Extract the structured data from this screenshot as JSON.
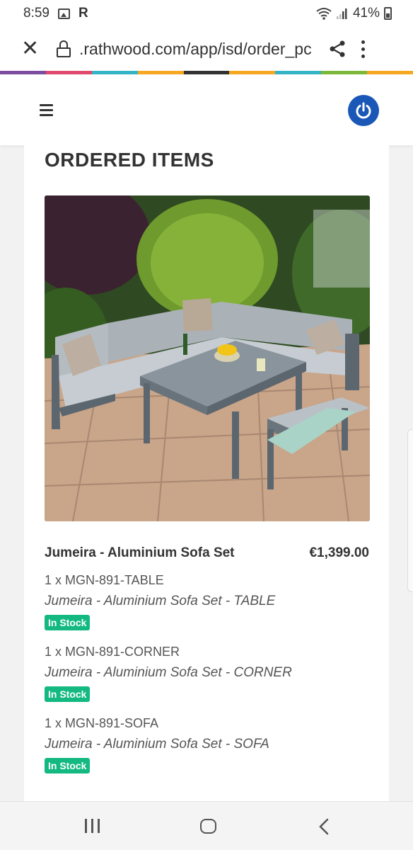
{
  "status_bar": {
    "time": "8:59",
    "r_label": "R",
    "battery": "41%"
  },
  "browser": {
    "url": ".rathwood.com/app/isd/order_pc"
  },
  "strip_colors": [
    "#7c4ca0",
    "#e04a6f",
    "#34b4c6",
    "#f7a823",
    "#333333",
    "#f7a823",
    "#34b4c6",
    "#7cb83a",
    "#f7a823"
  ],
  "section": {
    "title": "ORDERED ITEMS"
  },
  "product": {
    "name": "Jumeira - Aluminium Sofa Set",
    "price": "€1,399.00",
    "items": [
      {
        "sku": "1 x MGN-891-TABLE",
        "desc": "Jumeira - Aluminium Sofa Set - TABLE",
        "stock": "In Stock"
      },
      {
        "sku": "1 x MGN-891-CORNER",
        "desc": "Jumeira - Aluminium Sofa Set - CORNER",
        "stock": "In Stock"
      },
      {
        "sku": "1 x MGN-891-SOFA",
        "desc": "Jumeira - Aluminium Sofa Set - SOFA",
        "stock": "In Stock"
      }
    ]
  },
  "colors": {
    "accent": "#1b57b7",
    "in_stock": "#13b981"
  },
  "icons": {
    "close": "close-icon",
    "lock": "lock-icon",
    "share": "share-icon",
    "menu": "more-vert-icon",
    "hamburger": "hamburger-icon",
    "power": "power-icon"
  }
}
